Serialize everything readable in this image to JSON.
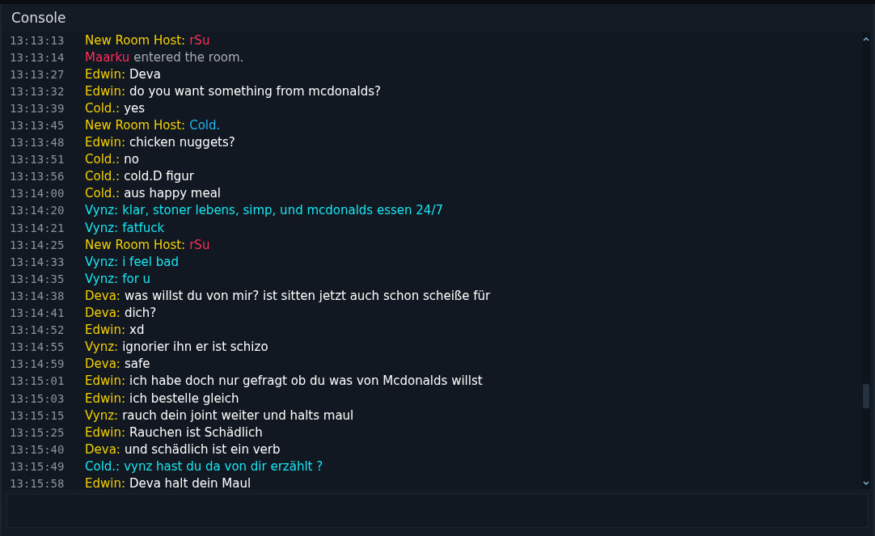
{
  "window": {
    "title": "Console"
  },
  "messages": [
    {
      "time": "13:13:13",
      "parts": [
        {
          "text": "New Room Host:",
          "color": "#f5d000"
        },
        {
          "text": "rSu",
          "color": "#ff2e5a"
        }
      ]
    },
    {
      "time": "13:13:14",
      "parts": [
        {
          "text": "Maarku",
          "color": "#ff2e5a"
        },
        {
          "text": "entered the room.",
          "color": "#a9adb3"
        }
      ]
    },
    {
      "time": "13:13:27",
      "parts": [
        {
          "text": "Edwin:",
          "color": "#f5d000"
        },
        {
          "text": "Deva",
          "color": "#ffffff"
        }
      ]
    },
    {
      "time": "13:13:32",
      "parts": [
        {
          "text": "Edwin:",
          "color": "#f5d000"
        },
        {
          "text": "do you want something from mcdonalds?",
          "color": "#ffffff"
        }
      ]
    },
    {
      "time": "13:13:39",
      "parts": [
        {
          "text": "Cold.:",
          "color": "#f5d000"
        },
        {
          "text": "yes",
          "color": "#ffffff"
        }
      ]
    },
    {
      "time": "13:13:45",
      "parts": [
        {
          "text": "New Room Host:",
          "color": "#f5d000"
        },
        {
          "text": "Cold.",
          "color": "#1fb6f0"
        }
      ]
    },
    {
      "time": "13:13:48",
      "parts": [
        {
          "text": "Edwin:",
          "color": "#f5d000"
        },
        {
          "text": "chicken nuggets?",
          "color": "#ffffff"
        }
      ]
    },
    {
      "time": "13:13:51",
      "parts": [
        {
          "text": "Cold.:",
          "color": "#f5d000"
        },
        {
          "text": "no",
          "color": "#ffffff"
        }
      ]
    },
    {
      "time": "13:13:56",
      "parts": [
        {
          "text": "Cold.:",
          "color": "#f5d000"
        },
        {
          "text": "cold.D figur",
          "color": "#ffffff"
        }
      ]
    },
    {
      "time": "13:14:00",
      "parts": [
        {
          "text": "Cold.:",
          "color": "#f5d000"
        },
        {
          "text": "aus happy meal",
          "color": "#ffffff"
        }
      ]
    },
    {
      "time": "13:14:20",
      "parts": [
        {
          "text": "Vynz:",
          "color": "#19e6f0"
        },
        {
          "text": "klar, stoner lebens, simp, und mcdonalds essen 24/7",
          "color": "#19e6f0"
        }
      ]
    },
    {
      "time": "13:14:21",
      "parts": [
        {
          "text": "Vynz:",
          "color": "#19e6f0"
        },
        {
          "text": "fatfuck",
          "color": "#19e6f0"
        }
      ]
    },
    {
      "time": "13:14:25",
      "parts": [
        {
          "text": "New Room Host:",
          "color": "#f5d000"
        },
        {
          "text": "rSu",
          "color": "#ff2e5a"
        }
      ]
    },
    {
      "time": "13:14:33",
      "parts": [
        {
          "text": "Vynz:",
          "color": "#19e6f0"
        },
        {
          "text": "i feel bad",
          "color": "#19e6f0"
        }
      ]
    },
    {
      "time": "13:14:35",
      "parts": [
        {
          "text": "Vynz:",
          "color": "#19e6f0"
        },
        {
          "text": "for u",
          "color": "#19e6f0"
        }
      ]
    },
    {
      "time": "13:14:38",
      "parts": [
        {
          "text": "Deva:",
          "color": "#f5d000"
        },
        {
          "text": "was willst du von mir? ist sitten jetzt auch schon scheiße für",
          "color": "#ffffff"
        }
      ]
    },
    {
      "time": "13:14:41",
      "parts": [
        {
          "text": "Deva:",
          "color": "#f5d000"
        },
        {
          "text": "dich?",
          "color": "#ffffff"
        }
      ]
    },
    {
      "time": "13:14:52",
      "parts": [
        {
          "text": "Edwin:",
          "color": "#f5d000"
        },
        {
          "text": "xd",
          "color": "#ffffff"
        }
      ]
    },
    {
      "time": "13:14:55",
      "parts": [
        {
          "text": "Vynz:",
          "color": "#f5d000"
        },
        {
          "text": "ignorier ihn er ist schizo",
          "color": "#ffffff"
        }
      ]
    },
    {
      "time": "13:14:59",
      "parts": [
        {
          "text": "Deva:",
          "color": "#f5d000"
        },
        {
          "text": "safe",
          "color": "#ffffff"
        }
      ]
    },
    {
      "time": "13:15:01",
      "parts": [
        {
          "text": "Edwin:",
          "color": "#f5d000"
        },
        {
          "text": "ich habe doch nur gefragt ob du was von Mcdonalds willst",
          "color": "#ffffff"
        }
      ]
    },
    {
      "time": "13:15:03",
      "parts": [
        {
          "text": "Edwin:",
          "color": "#f5d000"
        },
        {
          "text": "ich bestelle gleich",
          "color": "#ffffff"
        }
      ]
    },
    {
      "time": "13:15:15",
      "parts": [
        {
          "text": "Vynz:",
          "color": "#f5d000"
        },
        {
          "text": "rauch dein joint weiter und halts maul",
          "color": "#ffffff"
        }
      ]
    },
    {
      "time": "13:15:25",
      "parts": [
        {
          "text": "Edwin:",
          "color": "#f5d000"
        },
        {
          "text": "Rauchen ist Schädlich",
          "color": "#ffffff"
        }
      ]
    },
    {
      "time": "13:15:40",
      "parts": [
        {
          "text": "Deva:",
          "color": "#f5d000"
        },
        {
          "text": "und schädlich ist ein verb",
          "color": "#ffffff"
        }
      ]
    },
    {
      "time": "13:15:49",
      "parts": [
        {
          "text": "Cold.:",
          "color": "#19e6f0"
        },
        {
          "text": "vynz hast du da von dir erzählt ?",
          "color": "#19e6f0"
        }
      ]
    },
    {
      "time": "13:15:58",
      "parts": [
        {
          "text": "Edwin:",
          "color": "#f5d000"
        },
        {
          "text": "Deva halt dein Maul",
          "color": "#ffffff"
        }
      ]
    }
  ]
}
